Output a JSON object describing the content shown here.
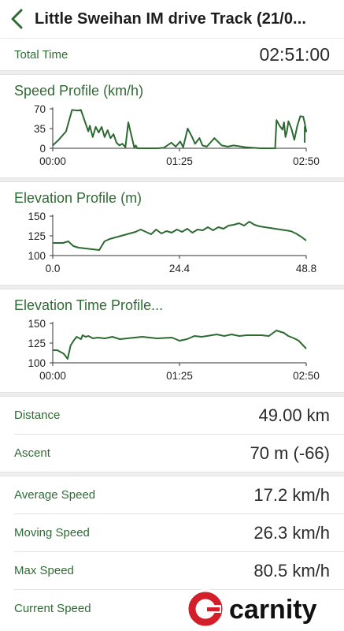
{
  "header": {
    "title": "Little Sweihan IM drive Track (21/0..."
  },
  "summary": {
    "total_time_label": "Total Time",
    "total_time_value": "02:51:00"
  },
  "charts": {
    "speed": {
      "title": "Speed Profile (km/h)"
    },
    "elevation": {
      "title": "Elevation Profile (m)"
    },
    "elevation_time": {
      "title": "Elevation Time Profile..."
    }
  },
  "chart_data": [
    {
      "type": "line",
      "title": "Speed Profile (km/h)",
      "x_ticks": [
        "00:00",
        "01:25",
        "02:50"
      ],
      "y_ticks": [
        0,
        35,
        70
      ],
      "ylim": [
        0,
        70
      ],
      "x": [
        0,
        4,
        9,
        13,
        17,
        19,
        24,
        25,
        27,
        29,
        31,
        33,
        35,
        37,
        39,
        41,
        43,
        45,
        47,
        49,
        51,
        55,
        56,
        57,
        59,
        61,
        65,
        71,
        75,
        80,
        83,
        86,
        88,
        91,
        94,
        96,
        99,
        101,
        104,
        109,
        114,
        118,
        122,
        130,
        140,
        150,
        151,
        153,
        155,
        156,
        157,
        158,
        159,
        161,
        163,
        165,
        167,
        169,
        170,
        171,
        170,
        170
      ],
      "y": [
        5,
        15,
        30,
        68,
        67,
        68,
        30,
        40,
        20,
        38,
        28,
        38,
        20,
        32,
        18,
        25,
        10,
        5,
        8,
        2,
        46,
        1,
        5,
        0,
        0,
        0,
        0,
        0,
        1,
        10,
        3,
        12,
        2,
        35,
        20,
        8,
        18,
        5,
        3,
        18,
        5,
        3,
        5,
        2,
        0,
        0,
        50,
        40,
        33,
        46,
        20,
        30,
        48,
        35,
        15,
        40,
        57,
        56,
        45,
        30,
        38,
        10
      ],
      "grid": false
    },
    {
      "type": "line",
      "title": "Elevation Profile (m)",
      "x_ticks": [
        0.0,
        24.4,
        48.8
      ],
      "y_ticks": [
        100,
        125,
        150
      ],
      "ylim": [
        100,
        150
      ],
      "x": [
        0,
        2,
        3,
        4,
        5,
        9,
        10,
        11,
        16,
        17,
        19,
        20,
        21,
        22,
        23,
        24,
        25,
        26,
        27,
        28,
        29,
        30,
        31,
        32,
        33,
        34,
        35,
        36,
        37,
        38,
        39,
        40,
        41,
        42,
        43,
        44,
        45,
        46,
        47,
        48,
        49
      ],
      "y": [
        116,
        116,
        118,
        112,
        110,
        107,
        118,
        121,
        130,
        133,
        127,
        133,
        128,
        131,
        129,
        133,
        130,
        134,
        129,
        133,
        132,
        136,
        132,
        136,
        134,
        138,
        139,
        141,
        138,
        143,
        139,
        137,
        136,
        135,
        134,
        133,
        132,
        131,
        128,
        124,
        119
      ],
      "grid": false
    },
    {
      "type": "line",
      "title": "Elevation Time Profile...",
      "x_ticks": [
        "00:00",
        "01:25",
        "02:50"
      ],
      "y_ticks": [
        100,
        125,
        150
      ],
      "ylim": [
        100,
        150
      ],
      "x": [
        0,
        3,
        5,
        7,
        8,
        10,
        12,
        14,
        16,
        19,
        20,
        22,
        24,
        27,
        30,
        35,
        40,
        45,
        50,
        60,
        70,
        80,
        85,
        90,
        95,
        100,
        110,
        115,
        120,
        125,
        130,
        140,
        145,
        150,
        155,
        158,
        162,
        165,
        168,
        170
      ],
      "y": [
        116,
        116,
        114,
        112,
        110,
        105,
        122,
        128,
        133,
        130,
        135,
        133,
        134,
        131,
        132,
        131,
        133,
        130,
        131,
        133,
        131,
        132,
        128,
        130,
        134,
        133,
        136,
        134,
        136,
        134,
        135,
        135,
        134,
        141,
        138,
        134,
        131,
        128,
        122,
        118
      ],
      "grid": false
    }
  ],
  "stats_distance": [
    {
      "label": "Distance",
      "value": "49.00 km"
    },
    {
      "label": "Ascent",
      "value": "70 m (-66)"
    }
  ],
  "stats_speed": [
    {
      "label": "Average Speed",
      "value": "17.2 km/h"
    },
    {
      "label": "Moving Speed",
      "value": "26.3 km/h"
    },
    {
      "label": "Max Speed",
      "value": "80.5 km/h"
    },
    {
      "label": "Current Speed",
      "value": ""
    }
  ],
  "watermark": {
    "text": "carnity"
  },
  "colors": {
    "accent_green": "#2f6b34",
    "line_green": "#2c6a31",
    "logo_red": "#d31f2a"
  }
}
